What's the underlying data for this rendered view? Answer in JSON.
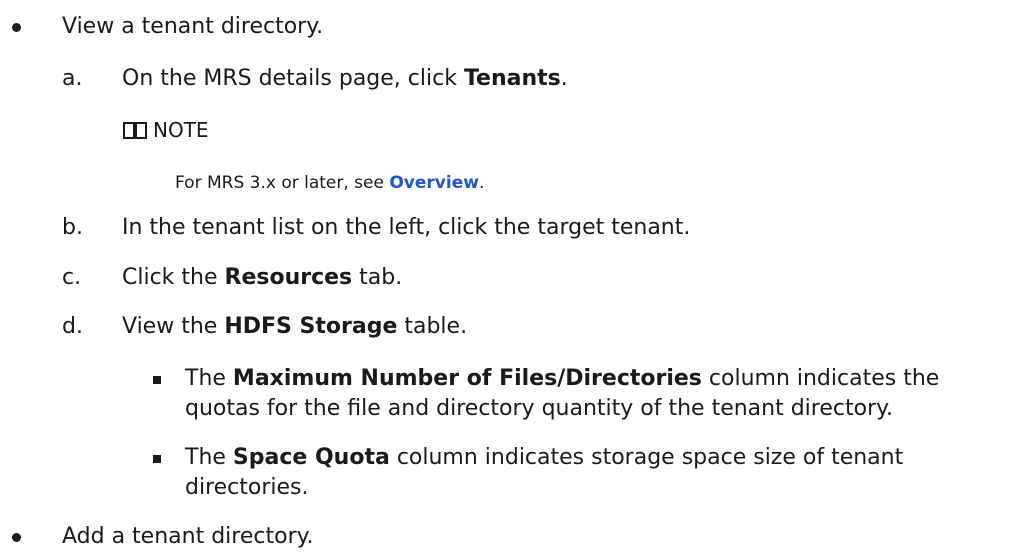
{
  "items": {
    "view": {
      "text": "View a tenant directory."
    },
    "step_a": {
      "marker": "a.",
      "pre": "On the MRS details page, click ",
      "bold": "Tenants",
      "post": "."
    },
    "note": {
      "label": "NOTE",
      "pre": "For MRS 3.x or later, see ",
      "link": "Overview",
      "post": "."
    },
    "step_b": {
      "marker": "b.",
      "text": "In the tenant list on the left, click the target tenant."
    },
    "step_c": {
      "marker": "c.",
      "pre": "Click the ",
      "bold": "Resources",
      "post": " tab."
    },
    "step_d": {
      "marker": "d.",
      "pre": "View the ",
      "bold": "HDFS Storage",
      "post": " table."
    },
    "sub1": {
      "pre": "The ",
      "bold": "Maximum Number of Files/Directories",
      "post": " column indicates the",
      "line2": "quotas for the file and directory quantity of the tenant directory."
    },
    "sub2": {
      "pre": "The ",
      "bold": "Space Quota",
      "post": " column indicates storage space size of tenant",
      "line2": "directories."
    },
    "add": {
      "text": "Add a tenant directory."
    }
  },
  "icons": {
    "note": "book-icon"
  },
  "colors": {
    "link": "#1f57c9",
    "text": "#1a1a1a"
  }
}
